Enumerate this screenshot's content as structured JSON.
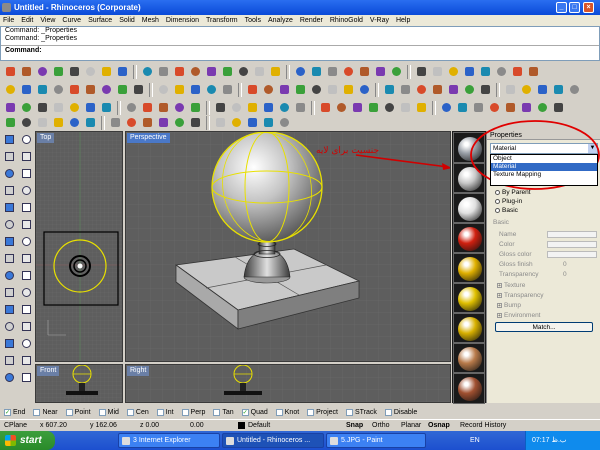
{
  "window": {
    "title": "Untitled - Rhinoceros (Corporate)",
    "min": "_",
    "max": "□",
    "close": "×"
  },
  "menu": [
    "File",
    "Edit",
    "View",
    "Curve",
    "Surface",
    "Solid",
    "Mesh",
    "Dimension",
    "Transform",
    "Tools",
    "Analyze",
    "Render",
    "RhinoGold",
    "V-Ray",
    "Help"
  ],
  "command": {
    "history": [
      "Command: _Properties",
      "Command: _Properties"
    ],
    "prompt": "Command:"
  },
  "viewports": {
    "top": "Top",
    "perspective": "Perspective",
    "front": "Front",
    "right": "Right"
  },
  "annotation": {
    "text": "جنسیت برای لایه"
  },
  "properties": {
    "panel_title": "Properties",
    "selected": "Material",
    "options": [
      "Object",
      "Material",
      "Texture Mapping"
    ],
    "radio": [
      "By Parent",
      "Plug-in",
      "Basic"
    ],
    "section": "Basic",
    "fields": [
      "Name",
      "Color",
      "Gloss color",
      "Gloss finish",
      "Transparency"
    ],
    "gloss_value": "0",
    "transparency_value": "0",
    "tree": [
      "Texture",
      "Transparency",
      "Bump",
      "Environment"
    ],
    "match_button": "Match..."
  },
  "swatch_colors": [
    "#9aa0a8",
    "#c8c8c8",
    "#e0e0e0",
    "#d02010",
    "#e0b000",
    "#e0c000",
    "#d8b000",
    "#b87a4a",
    "#a05030"
  ],
  "osnap": [
    {
      "label": "End",
      "checked": true
    },
    {
      "label": "Near",
      "checked": false
    },
    {
      "label": "Point",
      "checked": false
    },
    {
      "label": "Mid",
      "checked": false
    },
    {
      "label": "Cen",
      "checked": false
    },
    {
      "label": "Int",
      "checked": false
    },
    {
      "label": "Perp",
      "checked": false
    },
    {
      "label": "Tan",
      "checked": false
    },
    {
      "label": "Quad",
      "checked": true
    },
    {
      "label": "Knot",
      "checked": false
    },
    {
      "label": "Project",
      "checked": false
    },
    {
      "label": "STrack",
      "checked": false
    },
    {
      "label": "Disable",
      "checked": false
    }
  ],
  "status": {
    "cplane": "CPlane",
    "x": "x 607.20",
    "y": "y 162.06",
    "z": "z 0.00",
    "d": "0.00",
    "layer": "Default",
    "snap": "Snap",
    "ortho": "Ortho",
    "planar": "Planar",
    "osnap": "Osnap",
    "record": "Record History"
  },
  "taskbar": {
    "start": "start",
    "items": [
      "3 Internet Explorer",
      "Untitled - Rhinoceros ...",
      "5.JPG - Paint"
    ],
    "lang": "EN",
    "clock": "07:17 ب.ظ"
  }
}
